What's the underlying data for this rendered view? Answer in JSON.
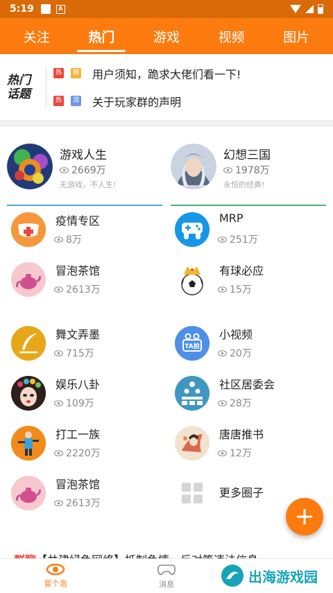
{
  "status_bar": {
    "time": "5:19",
    "a_icon": "A"
  },
  "tabs": [
    {
      "label": "关注",
      "active": false
    },
    {
      "label": "热门",
      "active": true
    },
    {
      "label": "游戏",
      "active": false
    },
    {
      "label": "视频",
      "active": false
    },
    {
      "label": "图片",
      "active": false
    }
  ],
  "hot_topics": {
    "logo_line1": "热门",
    "logo_line2": "话题",
    "rows": [
      {
        "badge1": "热",
        "badge2": "精",
        "text": "用户须知，跪求大佬们看一下!"
      },
      {
        "badge1": "热",
        "badge2": "顶",
        "text": "关于玩家群的声明"
      }
    ]
  },
  "featured": [
    {
      "title": "游戏人生",
      "count": "2669万",
      "subtitle": "无游戏，不人生!",
      "line_color": "#4aa8d8"
    },
    {
      "title": "幻想三国",
      "count": "1978万",
      "subtitle": "永恒的经典!",
      "line_color": "#3cb878"
    }
  ],
  "circles": [
    {
      "name": "疫情专区",
      "count": "8万",
      "icon": "mask-icon"
    },
    {
      "name": "MRP",
      "count": "251万",
      "icon": "gamepad-icon"
    },
    {
      "name": "冒泡茶馆",
      "count": "2613万",
      "icon": "teapot-icon"
    },
    {
      "name": "有球必应",
      "count": "15万",
      "icon": "soccer-crown-icon"
    },
    {
      "name": "舞文弄墨",
      "count": "715万",
      "icon": "quill-icon"
    },
    {
      "name": "小视频",
      "count": "20万",
      "icon": "ta-video-icon",
      "icon_text": "TA拍"
    },
    {
      "name": "娱乐八卦",
      "count": "109万",
      "icon": "opera-face-icon"
    },
    {
      "name": "社区居委会",
      "count": "28万",
      "icon": "community-icon"
    },
    {
      "name": "打工一族",
      "count": "2220万",
      "icon": "worker-icon"
    },
    {
      "name": "唐唐推书",
      "count": "12万",
      "icon": "painting-icon"
    },
    {
      "name": "冒泡茶馆",
      "count": "2613万",
      "icon": "teapot-icon"
    },
    {
      "name": "更多圈子",
      "count": "",
      "icon": "grid-more-icon"
    }
  ],
  "feed_peek": {
    "lead": "群聊",
    "text": "【共建绿色网络】抵制色情，反对策违法信息"
  },
  "bottom_nav": [
    {
      "label": "冒个泡",
      "icon": "eye-icon",
      "active": true
    },
    {
      "label": "消息",
      "icon": "gamepad-outline-icon",
      "active": false
    }
  ],
  "watermark": {
    "text": "出海游戏园"
  },
  "colors": {
    "accent": "#fc7b0e",
    "status_bar": "#d96a07",
    "hot_red": "#e9473d"
  }
}
